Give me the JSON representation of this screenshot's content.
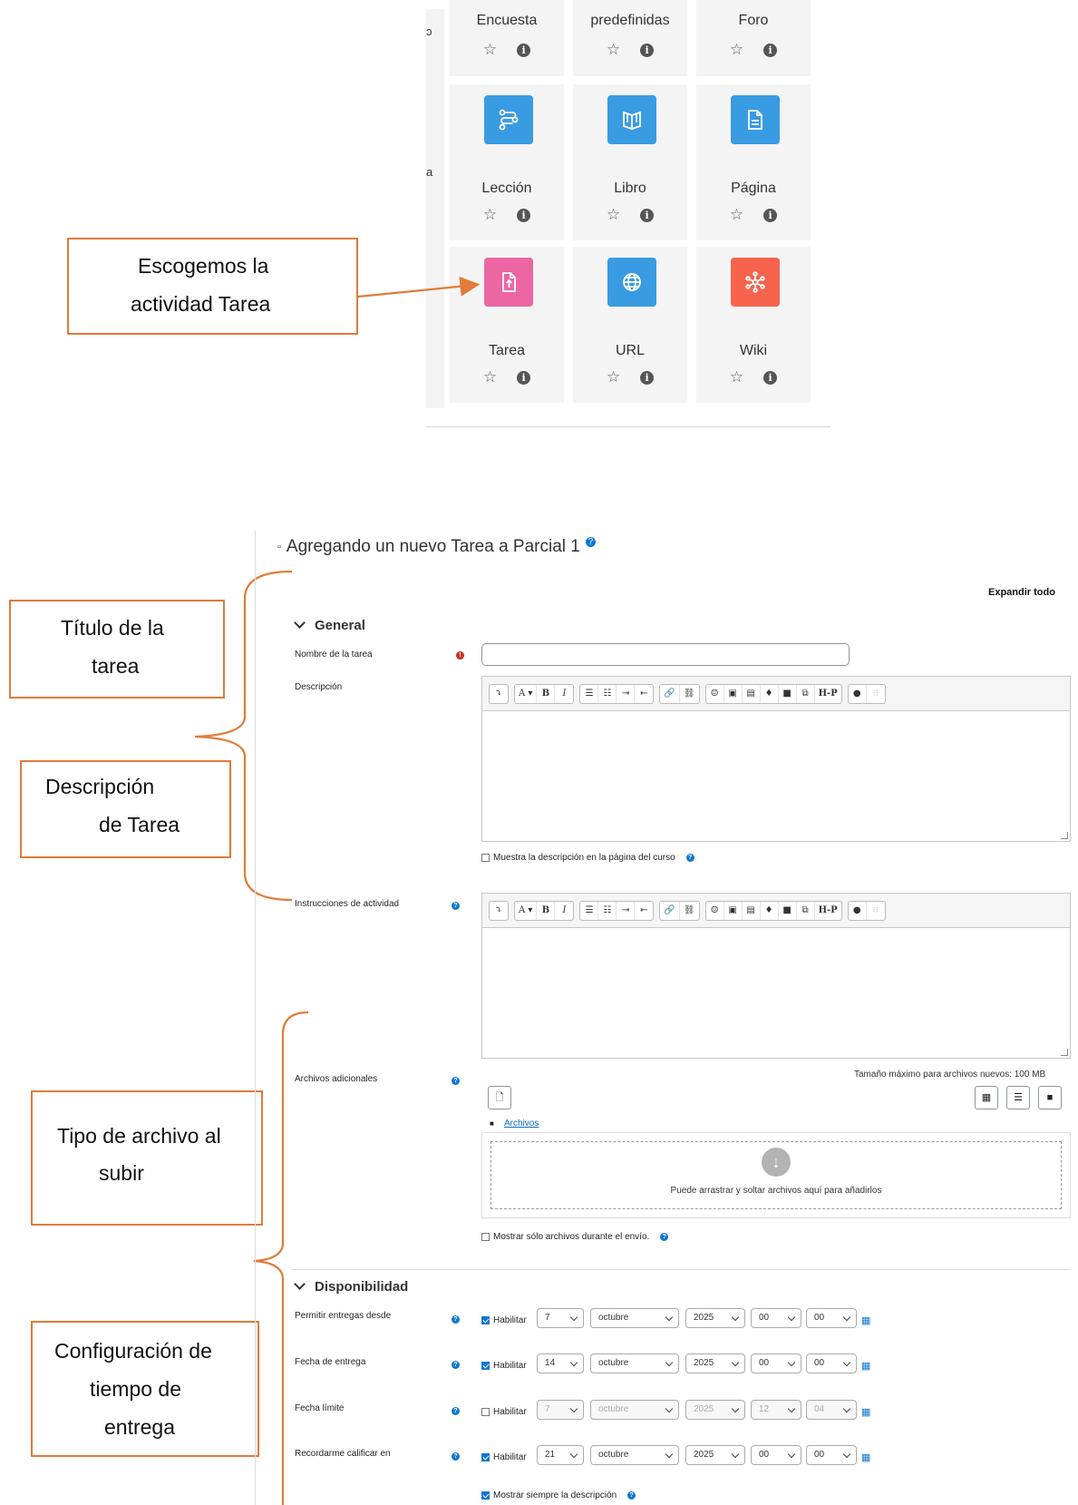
{
  "chooser": {
    "edge_text_1": "ɔ",
    "edge_text_2": "a",
    "tiles": [
      {
        "label": "Encuesta",
        "icon": "none"
      },
      {
        "label": "predefinidas",
        "icon": "none"
      },
      {
        "label": "Foro",
        "icon": "none"
      },
      {
        "label": "Lección",
        "icon": "lesson-icon",
        "color": "#399be2"
      },
      {
        "label": "Libro",
        "icon": "book-icon",
        "color": "#399be2"
      },
      {
        "label": "Página",
        "icon": "page-icon",
        "color": "#399be2"
      },
      {
        "label": "Tarea",
        "icon": "assignment-upload-icon",
        "color": "#eb66a2"
      },
      {
        "label": "URL",
        "icon": "globe-icon",
        "color": "#399be2"
      },
      {
        "label": "Wiki",
        "icon": "wiki-icon",
        "color": "#f7634d"
      }
    ],
    "star_glyph": "☆",
    "info_glyph": "i"
  },
  "callouts": {
    "activity": [
      "Escogemos la",
      "actividad Tarea"
    ],
    "title": [
      "Título de la",
      "tarea"
    ],
    "description": [
      "Descripción",
      "de Tarea"
    ],
    "filetype": [
      "Tipo de archivo al",
      "subir"
    ],
    "time": [
      "Configuración de",
      "tiempo de",
      "entrega"
    ]
  },
  "colors": {
    "accent": "#e07b39",
    "primary": "#1177d1",
    "required": "#ca3120"
  },
  "form": {
    "heading": "Agregando un nuevo Tarea a Parcial 1",
    "expand_all": "Expandir todo",
    "general": "General",
    "name_label": "Nombre de la tarea",
    "name_value": "",
    "description_label": "Descripción",
    "show_description": "Muestra la descripción en la página del curso",
    "instructions_label": "Instrucciones de actividad",
    "extra_files_label": "Archivos adicionales",
    "max_size": "Tamaño máximo para archivos nuevos: 100 MB",
    "files_link": "Archivos",
    "drop_text": "Puede arrastrar y soltar archivos aquí para añadirlos",
    "only_files": "Mostrar sólo archivos durante el envío.",
    "availability": "Disponibilidad",
    "enable_label": "Habilitar",
    "always_show": "Mostrar siempre la descripción",
    "toolbar": [
      "⤵",
      "A ▾",
      "B",
      "I",
      "☰",
      "☷",
      "⇥",
      "⇤",
      "🔗",
      "⛓",
      "☺",
      "▣",
      "▤",
      "♦",
      "■",
      "⧉",
      "H-P",
      "●",
      "⁝⁝"
    ],
    "dates": [
      {
        "label": "Permitir entregas desde",
        "enabled": true,
        "day": "7",
        "month": "octubre",
        "year": "2025",
        "hour": "00",
        "minute": "00"
      },
      {
        "label": "Fecha de entrega",
        "enabled": true,
        "day": "14",
        "month": "octubre",
        "year": "2025",
        "hour": "00",
        "minute": "00"
      },
      {
        "label": "Fecha límite",
        "enabled": false,
        "day": "7",
        "month": "octubre",
        "year": "2025",
        "hour": "12",
        "minute": "04"
      },
      {
        "label": "Recordarme calificar en",
        "enabled": true,
        "day": "21",
        "month": "octubre",
        "year": "2025",
        "hour": "00",
        "minute": "00"
      }
    ]
  }
}
